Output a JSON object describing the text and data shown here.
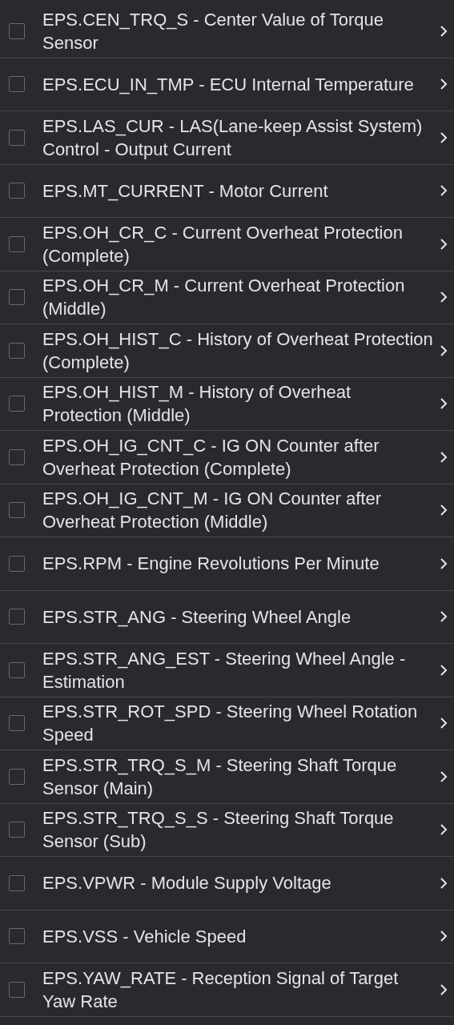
{
  "items": [
    {
      "label": "EPS.CEN_TRQ_S - Center Value of Torque Sensor",
      "checked": false
    },
    {
      "label": "EPS.ECU_IN_TMP - ECU Internal Temperature",
      "checked": false
    },
    {
      "label": "EPS.LAS_CUR - LAS(Lane-keep Assist System) Control - Output Current",
      "checked": false
    },
    {
      "label": "EPS.MT_CURRENT - Motor Current",
      "checked": false
    },
    {
      "label": "EPS.OH_CR_C - Current Overheat Protection (Complete)",
      "checked": false
    },
    {
      "label": "EPS.OH_CR_M - Current Overheat Protection (Middle)",
      "checked": false
    },
    {
      "label": "EPS.OH_HIST_C - History of Overheat Protection (Complete)",
      "checked": false
    },
    {
      "label": "EPS.OH_HIST_M - History of Overheat Protection (Middle)",
      "checked": false
    },
    {
      "label": "EPS.OH_IG_CNT_C - IG ON Counter after Overheat Protection (Complete)",
      "checked": false
    },
    {
      "label": "EPS.OH_IG_CNT_M - IG ON Counter after Overheat Protection (Middle)",
      "checked": false
    },
    {
      "label": "EPS.RPM - Engine Revolutions Per Minute",
      "checked": false
    },
    {
      "label": "EPS.STR_ANG - Steering Wheel Angle",
      "checked": false
    },
    {
      "label": "EPS.STR_ANG_EST - Steering Wheel Angle - Estimation",
      "checked": false
    },
    {
      "label": "EPS.STR_ROT_SPD - Steering Wheel Rotation Speed",
      "checked": false
    },
    {
      "label": "EPS.STR_TRQ_S_M - Steering Shaft Torque Sensor (Main)",
      "checked": false
    },
    {
      "label": "EPS.STR_TRQ_S_S - Steering Shaft Torque Sensor (Sub)",
      "checked": false
    },
    {
      "label": "EPS.VPWR - Module Supply Voltage",
      "checked": false
    },
    {
      "label": "EPS.VSS - Vehicle Speed",
      "checked": false
    },
    {
      "label": "EPS.YAW_RATE - Reception Signal of Target Yaw Rate",
      "checked": false
    }
  ]
}
